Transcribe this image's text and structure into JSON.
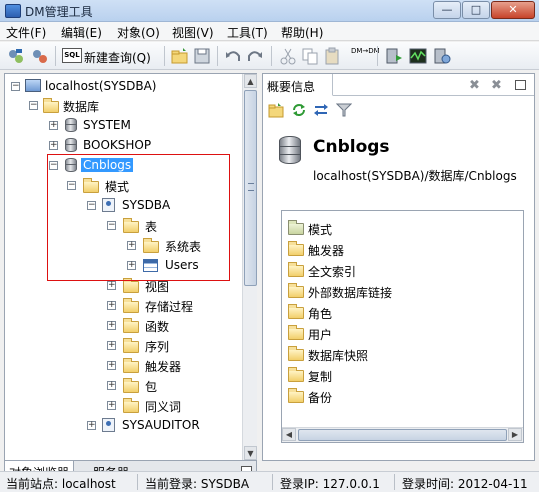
{
  "window": {
    "title": "DM管理工具",
    "min_label": "—",
    "max_label": "□",
    "close_label": "✕"
  },
  "menu": [
    "文件(F)",
    "编辑(E)",
    "对象(O)",
    "视图(V)",
    "工具(T)",
    "帮助(H)"
  ],
  "toolbar": {
    "new_query_label": "新建查询(Q)",
    "sql_icon_text": "SQL",
    "dm_icon_text": "DM→DM"
  },
  "tree": {
    "host": "localhost(SYSDBA)",
    "databases": "数据库",
    "system": "SYSTEM",
    "bookshop": "BOOKSHOP",
    "cnblogs": "Cnblogs",
    "schema": "模式",
    "sysdba": "SYSDBA",
    "tables": "表",
    "system_tables": "系统表",
    "users": "Users",
    "views": "视图",
    "procedures": "存储过程",
    "functions": "函数",
    "sequences": "序列",
    "triggers": "触发器",
    "packages": "包",
    "synonyms": "同义词",
    "sysauditor": "SYSAUDITOR"
  },
  "left_tabs": {
    "object_browser": "对象浏览器",
    "servers": "服务器"
  },
  "overview": {
    "tab_label": "概要信息",
    "db_name": "Cnblogs",
    "db_path": "localhost(SYSDBA)/数据库/Cnblogs",
    "items": [
      "模式",
      "触发器",
      "全文索引",
      "外部数据库链接",
      "角色",
      "用户",
      "数据库快照",
      "复制",
      "备份"
    ]
  },
  "status": {
    "current_site": "当前站点: localhost",
    "current_login": "当前登录: SYSDBA",
    "login_ip": "登录IP: 127.0.0.1",
    "login_time": "登录时间: 2012-04-11"
  },
  "colors": {
    "selection": "#3399ff",
    "highlight_box": "#dd1111"
  }
}
